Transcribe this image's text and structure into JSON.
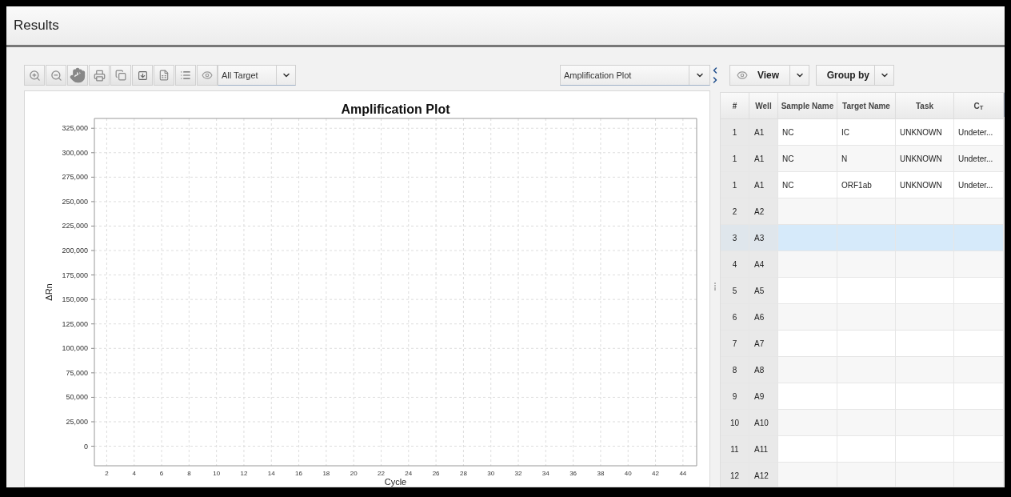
{
  "header": {
    "title": "Results"
  },
  "toolbar": {
    "target_select": {
      "value": "All Target"
    },
    "plot_select": {
      "value": "Amplification Plot"
    }
  },
  "chart_data": {
    "type": "line",
    "title": "Amplification Plot",
    "xlabel": "Cycle",
    "ylabel": "ΔRn",
    "grid": true,
    "xlim": [
      1.1,
      45
    ],
    "ylim": [
      -20000,
      335000
    ],
    "xticks": [
      2,
      4,
      6,
      8,
      10,
      12,
      14,
      16,
      18,
      20,
      22,
      24,
      26,
      28,
      30,
      32,
      34,
      36,
      38,
      40,
      42,
      44
    ],
    "yticks": [
      {
        "value": 0,
        "label": "0"
      },
      {
        "value": 25000,
        "label": "25,000"
      },
      {
        "value": 50000,
        "label": "50,000"
      },
      {
        "value": 75000,
        "label": "75,000"
      },
      {
        "value": 100000,
        "label": "100,000"
      },
      {
        "value": 125000,
        "label": "125,000"
      },
      {
        "value": 150000,
        "label": "150,000"
      },
      {
        "value": 175000,
        "label": "175,000"
      },
      {
        "value": 200000,
        "label": "200,000"
      },
      {
        "value": 225000,
        "label": "225,000"
      },
      {
        "value": 250000,
        "label": "250,000"
      },
      {
        "value": 275000,
        "label": "275,000"
      },
      {
        "value": 300000,
        "label": "300,000"
      },
      {
        "value": 325000,
        "label": "325,000"
      }
    ]
  },
  "table_toolbar": {
    "view_button": {
      "label": "View"
    },
    "group_by_button": {
      "label": "Group by"
    }
  },
  "table": {
    "columns": [
      "#",
      "Well",
      "Sample Name",
      "Target Name",
      "Task",
      "C$_{T}$"
    ],
    "rows": [
      {
        "number": "1",
        "well": "A1",
        "sample": "NC",
        "target": "IC",
        "task": "UNKNOWN",
        "ct": "Undeter...",
        "selected": false
      },
      {
        "number": "1",
        "well": "A1",
        "sample": "NC",
        "target": "N",
        "task": "UNKNOWN",
        "ct": "Undeter...",
        "selected": false
      },
      {
        "number": "1",
        "well": "A1",
        "sample": "NC",
        "target": "ORF1ab",
        "task": "UNKNOWN",
        "ct": "Undeter...",
        "selected": false
      },
      {
        "number": "2",
        "well": "A2",
        "selected": false
      },
      {
        "number": "3",
        "well": "A3",
        "selected": true
      },
      {
        "number": "4",
        "well": "A4",
        "selected": false
      },
      {
        "number": "5",
        "well": "A5",
        "selected": false
      },
      {
        "number": "6",
        "well": "A6",
        "selected": false
      },
      {
        "number": "7",
        "well": "A7",
        "selected": false
      },
      {
        "number": "8",
        "well": "A8",
        "selected": false
      },
      {
        "number": "9",
        "well": "A9",
        "selected": false
      },
      {
        "number": "10",
        "well": "A10",
        "selected": false
      },
      {
        "number": "11",
        "well": "A11",
        "selected": false
      },
      {
        "number": "12",
        "well": "A12",
        "selected": false
      }
    ]
  }
}
